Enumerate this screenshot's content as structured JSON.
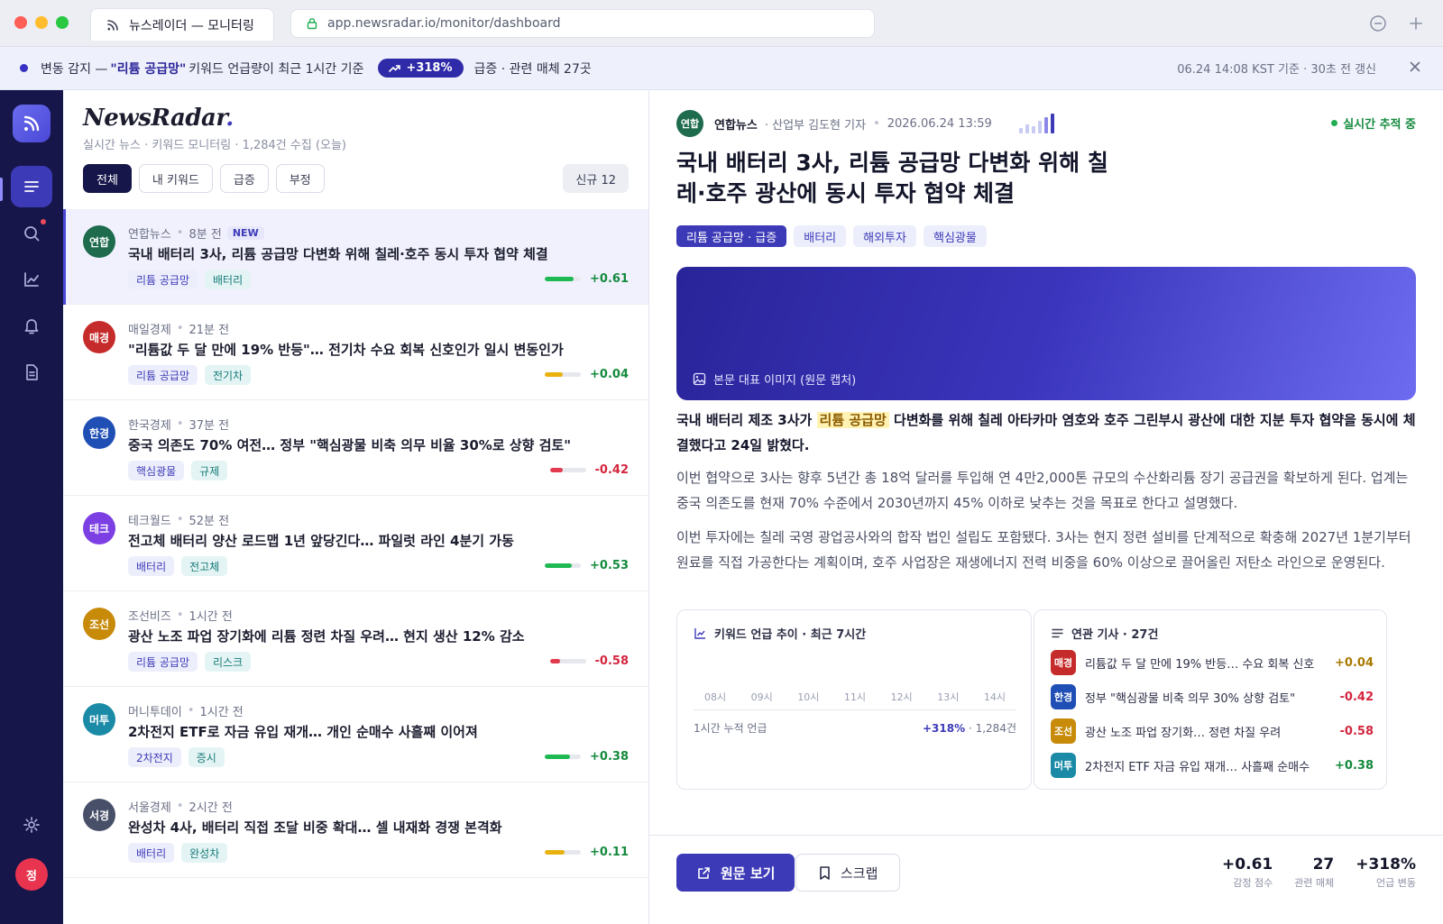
{
  "browser": {
    "tab_title": "뉴스레이더 — 모니터링",
    "url": "app.newsradar.io/monitor/dashboard"
  },
  "alert": {
    "prefix": "변동 감지 —",
    "keyword": "\"리튬 공급망\"",
    "text1": "키워드 언급량이 최근 1시간 기준",
    "change": "+318%",
    "text2": "급증 · 관련 매체 27곳",
    "meta": "06.24 14:08 KST 기준 · 30초 전 갱신"
  },
  "list": {
    "brand_main": "NewsRadar",
    "brand_dot": ".",
    "subtitle": "실시간 뉴스 · 키워드 모니터링 · 1,284건 수집 (오늘)",
    "filters": [
      "전체",
      "내 키워드",
      "급증",
      "부정"
    ],
    "new_count": "신규 12",
    "items": [
      {
        "abbr": "연합",
        "color": "#1e6b4e",
        "source": "연합뉴스",
        "time": "8분 전",
        "badge": "NEW",
        "title": "국내 배터리 3사, 리튬 공급망 다변화 위해 칠레·호주 동시 투자 협약 체결",
        "tags": [
          "리튬 공급망",
          "배터리"
        ],
        "score": "+0.61",
        "level": 0.8,
        "bar_color": "#1fb954"
      },
      {
        "abbr": "매경",
        "color": "#c62b2b",
        "source": "매일경제",
        "time": "21분 전",
        "title": "\"리튬값 두 달 만에 19% 반등\"… 전기차 수요 회복 신호인가 일시 변동인가",
        "tags": [
          "리튬 공급망",
          "전기차"
        ],
        "score": "+0.04",
        "level": 0.5,
        "bar_color": "#e9b10b"
      },
      {
        "abbr": "한경",
        "color": "#1f4fb5",
        "source": "한국경제",
        "time": "37분 전",
        "title": "중국 의존도 70% 여전… 정부 \"핵심광물 비축 의무 비율 30%로 상향 검토\"",
        "tags": [
          "핵심광물",
          "규제"
        ],
        "score": "-0.42",
        "level": 0.35,
        "bar_color": "#e23a4e"
      },
      {
        "abbr": "테크",
        "color": "#7b3fe4",
        "source": "테크월드",
        "time": "52분 전",
        "title": "전고체 배터리 양산 로드맵 1년 앞당긴다… 파일럿 라인 4분기 가동",
        "tags": [
          "배터리",
          "전고체"
        ],
        "score": "+0.53",
        "level": 0.75,
        "bar_color": "#1fb954"
      },
      {
        "abbr": "조선",
        "color": "#c78a09",
        "source": "조선비즈",
        "time": "1시간 전",
        "title": "광산 노조 파업 장기화에 리튬 정련 차질 우려… 현지 생산 12% 감소",
        "tags": [
          "리튬 공급망",
          "리스크"
        ],
        "score": "-0.58",
        "level": 0.28,
        "bar_color": "#e23a4e"
      },
      {
        "abbr": "머투",
        "color": "#1a8aa6",
        "source": "머니투데이",
        "time": "1시간 전",
        "title": "2차전지 ETF로 자금 유입 재개… 개인 순매수 사흘째 이어져",
        "tags": [
          "2차전지",
          "증시"
        ],
        "score": "+0.38",
        "level": 0.7,
        "bar_color": "#1fb954"
      },
      {
        "abbr": "서경",
        "color": "#475068",
        "source": "서울경제",
        "time": "2시간 전",
        "title": "완성차 4사, 배터리 직접 조달 비중 확대… 셀 내재화 경쟁 본격화",
        "tags": [
          "배터리",
          "완성차"
        ],
        "score": "+0.11",
        "level": 0.55,
        "bar_color": "#e9b10b"
      }
    ]
  },
  "detail": {
    "abbr": "연합",
    "source": "연합뉴스",
    "reporter": "· 산업부 김도현 기자",
    "datetime": "2026.06.24 13:59",
    "live": "실시간 추적 중",
    "title": "국내 배터리 3사, 리튬 공급망 다변화 위해 칠레·호주 광산에 동시 투자 협약 체결",
    "tags": [
      "리튬 공급망 · 급증",
      "배터리",
      "해외투자",
      "핵심광물"
    ],
    "image_caption": "본문 대표 이미지 (원문 캡처)",
    "lead_pre": "국내 배터리 제조 3사가",
    "lead_hl": "리튬 공급망",
    "lead_post": "다변화를 위해 칠레 아타카마 염호와 호주 그린부시 광산에 대한 지분 투자 협약을 동시에 체결했다고 24일 밝혔다.",
    "para2": "이번 협약으로 3사는 향후 5년간 총 18억 달러를 투입해 연 4만2,000톤 규모의 수산화리튬 장기 공급권을 확보하게 된다. 업계는 중국 의존도를 현재 70% 수준에서 2030년까지 45% 이하로 낮추는 것을 목표로 한다고 설명했다.",
    "para3": "이번 투자에는 칠레 국영 광업공사와의 합작 법인 설립도 포함됐다. 3사는 현지 정련 설비를 단계적으로 확충해 2027년 1분기부터 원료를 직접 가공한다는 계획이며, 호주 사업장은 재생에너지 전력 비중을 60% 이상으로 끌어올린 저탄소 라인으로 운영된다.",
    "trend": {
      "title": "키워드 언급 추이 · 최근 7시간",
      "hours": [
        "08시",
        "09시",
        "10시",
        "11시",
        "12시",
        "13시",
        "14시"
      ],
      "foot_label": "1시간 누적 언급",
      "foot_change": "+318%",
      "foot_count": "· 1,284건"
    },
    "related": {
      "title": "연관 기사 · 27건",
      "items": [
        {
          "abbr": "매경",
          "color": "#c62b2b",
          "title": "리튬값 두 달 만에 19% 반등… 수요 회복 신호",
          "score": "+0.04",
          "tone": "warn"
        },
        {
          "abbr": "한경",
          "color": "#1f4fb5",
          "title": "정부 \"핵심광물 비축 의무 30% 상향 검토\"",
          "score": "-0.42",
          "tone": "neg"
        },
        {
          "abbr": "조선",
          "color": "#c78a09",
          "title": "광산 노조 파업 장기화… 정련 차질 우려",
          "score": "-0.58",
          "tone": "neg"
        },
        {
          "abbr": "머투",
          "color": "#1a8aa6",
          "title": "2차전지 ETF 자금 유입 재개… 사흘째 순매수",
          "score": "+0.38",
          "tone": "pos"
        }
      ]
    },
    "actions": {
      "open": "원문 보기",
      "scrap": "스크랩"
    },
    "stats": [
      {
        "value": "+0.61",
        "label": "감정 점수"
      },
      {
        "value": "27",
        "label": "관련 매체"
      },
      {
        "value": "+318%",
        "label": "언급 변동"
      }
    ]
  }
}
